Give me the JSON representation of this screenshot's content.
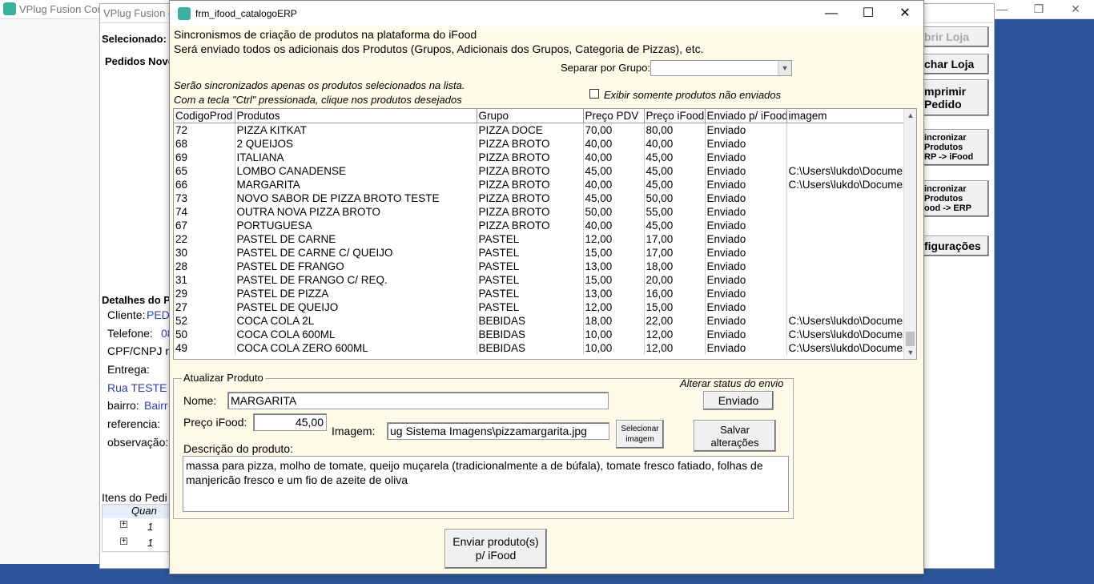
{
  "outer": {
    "title": "VPlug Fusion Conn",
    "controls": [
      "—",
      "❐",
      "✕"
    ]
  },
  "mid": {
    "title": "VPlug Fusion Co",
    "selected_label": "Selecionado:",
    "orders_label": "Pedidos Novo",
    "details_label": "Detalhes do P",
    "cliente_label": "Cliente:",
    "cliente_value": "PEDI",
    "telefone_label": "Telefone:",
    "telefone_value": "08",
    "cpf_label": "CPF/CNPJ n",
    "entrega_label": "Entrega:",
    "rua_value": "Rua TESTE",
    "bairro_label": "bairro:",
    "bairro_value": "Bairr",
    "referencia_label": "referencia:",
    "observacao_label": "observação:",
    "itens_label": "Itens do Pedi",
    "quant_header": "Quan",
    "item_rows": [
      "1",
      "1"
    ],
    "buttons": [
      "brir Loja",
      "char Loja",
      "mprimir",
      "Pedido",
      "incronizar",
      "Produtos",
      "RP -> iFood",
      "incronizar",
      "Produtos",
      "ood -> ERP",
      "figurações"
    ]
  },
  "dialog": {
    "title": "frm_ifood_catalogoERP",
    "controls": [
      "—",
      "☐",
      "✕"
    ],
    "heading1": "Sincronismos de criação de produtos na plataforma do iFood",
    "heading2": "Será enviado todos os adicionais dos Produtos (Grupos, Adicionais dos Grupos, Categoria de Pizzas), etc.",
    "group_label": "Separar por Grupo:",
    "group_value": "",
    "hint1": "Serão sincronizados apenas os produtos selecionados na lista.",
    "hint2": "Com a tecla \"Ctrl\" pressionada, clique nos produtos desejados",
    "only_unsent_label": "Exibir somente produtos não enviados",
    "columns": [
      "CodigoProd",
      "Produtos",
      "Grupo",
      "Preço PDV",
      "Preço iFood",
      "Enviado p/ iFood",
      "imagem"
    ],
    "rows": [
      [
        "72",
        "PIZZA KITKAT",
        "PIZZA DOCE",
        "70,00",
        "80,00",
        "Enviado",
        ""
      ],
      [
        "68",
        "2 QUEIJOS",
        "PIZZA BROTO",
        "40,00",
        "40,00",
        "Enviado",
        ""
      ],
      [
        "69",
        "ITALIANA",
        "PIZZA BROTO",
        "40,00",
        "45,00",
        "Enviado",
        ""
      ],
      [
        "65",
        "LOMBO CANADENSE",
        "PIZZA BROTO",
        "45,00",
        "45,00",
        "Enviado",
        "C:\\Users\\lukdo\\Documen"
      ],
      [
        "66",
        "MARGARITA",
        "PIZZA BROTO",
        "40,00",
        "45,00",
        "Enviado",
        "C:\\Users\\lukdo\\Documen"
      ],
      [
        "73",
        "NOVO SABOR DE PIZZA BROTO TESTE",
        "PIZZA BROTO",
        "45,00",
        "50,00",
        "Enviado",
        ""
      ],
      [
        "74",
        "OUTRA NOVA PIZZA BROTO",
        "PIZZA BROTO",
        "50,00",
        "55,00",
        "Enviado",
        ""
      ],
      [
        "67",
        "PORTUGUESA",
        "PIZZA BROTO",
        "40,00",
        "45,00",
        "Enviado",
        ""
      ],
      [
        "22",
        "PASTEL DE CARNE",
        "PASTEL",
        "12,00",
        "17,00",
        "Enviado",
        ""
      ],
      [
        "30",
        "PASTEL DE CARNE C/ QUEIJO",
        "PASTEL",
        "15,00",
        "17,00",
        "Enviado",
        ""
      ],
      [
        "28",
        "PASTEL DE FRANGO",
        "PASTEL",
        "13,00",
        "18,00",
        "Enviado",
        ""
      ],
      [
        "31",
        "PASTEL DE FRANGO C/ REQ.",
        "PASTEL",
        "15,00",
        "20,00",
        "Enviado",
        ""
      ],
      [
        "29",
        "PASTEL DE PIZZA",
        "PASTEL",
        "13,00",
        "16,00",
        "Enviado",
        ""
      ],
      [
        "27",
        "PASTEL DE QUEIJO",
        "PASTEL",
        "12,00",
        "15,00",
        "Enviado",
        ""
      ],
      [
        "52",
        "COCA COLA 2L",
        "BEBIDAS",
        "18,00",
        "22,00",
        "Enviado",
        "C:\\Users\\lukdo\\Documen"
      ],
      [
        "50",
        "COCA COLA 600ML",
        "BEBIDAS",
        "10,00",
        "12,00",
        "Enviado",
        "C:\\Users\\lukdo\\Documen"
      ],
      [
        "49",
        "COCA COLA ZERO 600ML",
        "BEBIDAS",
        "10,00",
        "12,00",
        "Enviado",
        "C:\\Users\\lukdo\\Documen"
      ]
    ],
    "update": {
      "legend": "Atualizar Produto",
      "status_label": "Alterar status do envio",
      "status_button": "Enviado",
      "name_label": "Nome:",
      "name_value": "MARGARITA",
      "price_label": "Preço iFood:",
      "price_value": "45,00",
      "image_label": "Imagem:",
      "image_value": "ug Sistema Imagens\\pizzamargarita.jpg",
      "select_image_1": "Selecionar",
      "select_image_2": "imagem",
      "save_1": "Salvar",
      "save_2": "alterações",
      "desc_label": "Descrição do produto:",
      "desc_value": "massa para pizza, molho de tomate, queijo muçarela (tradicionalmente a de búfala), tomate fresco fatiado, folhas de manjericão fresco e um fio de azeite de oliva"
    },
    "send_1": "Enviar produto(s)",
    "send_2": "p/ iFood"
  }
}
